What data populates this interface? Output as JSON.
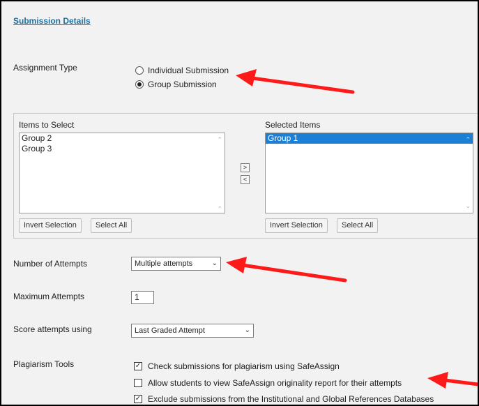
{
  "section": {
    "title": "Submission Details"
  },
  "assignment_type": {
    "label": "Assignment Type",
    "options": [
      {
        "label": "Individual Submission",
        "checked": false
      },
      {
        "label": "Group Submission",
        "checked": true
      }
    ]
  },
  "items_panel": {
    "available_label": "Items to Select",
    "available_items": [
      "Group 2",
      "Group 3"
    ],
    "selected_label": "Selected Items",
    "selected_items": [
      "Group 1"
    ],
    "move_right": ">",
    "move_left": "<",
    "invert_selection": "Invert Selection",
    "select_all": "Select All"
  },
  "attempts": {
    "label": "Number of Attempts",
    "value": "Multiple attempts"
  },
  "max_attempts": {
    "label": "Maximum Attempts",
    "value": "1"
  },
  "score_attempts": {
    "label": "Score attempts using",
    "value": "Last Graded Attempt"
  },
  "plagiarism": {
    "label": "Plagiarism Tools",
    "options": [
      {
        "label": "Check submissions for plagiarism using SafeAssign",
        "checked": true
      },
      {
        "label": "Allow students to view SafeAssign originality report for their attempts",
        "checked": false
      },
      {
        "label": "Exclude submissions from the Institutional and Global References Databases",
        "checked": true
      }
    ]
  },
  "colors": {
    "arrow": "#ff1a1a",
    "link": "#1f6fa0",
    "selection": "#1c7fd6"
  },
  "icons": {
    "chevron": "chevron-down-icon",
    "check": "check-icon"
  }
}
